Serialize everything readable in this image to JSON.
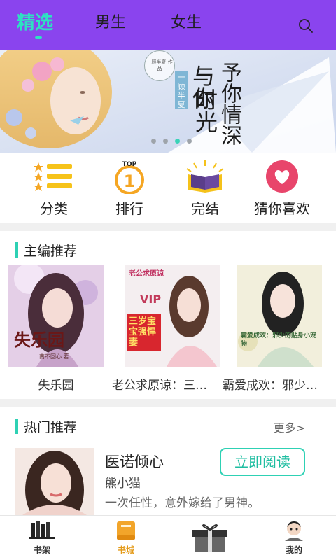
{
  "header": {
    "tabs": [
      {
        "label": "精选",
        "active": true
      },
      {
        "label": "男生",
        "active": false
      },
      {
        "label": "女生",
        "active": false
      }
    ],
    "search_icon": "search-icon",
    "background_color": "#8a44ee",
    "active_color": "#2ee0c2"
  },
  "banner": {
    "title_line1": "与你",
    "title_line2": "时光",
    "title_line3": "予你情深",
    "author_tag": "一顾半夏",
    "badge_text": "一顾半夏 作品",
    "dots": [
      false,
      false,
      true,
      false
    ]
  },
  "categories": [
    {
      "label": "分类",
      "icon": "list-icon"
    },
    {
      "label": "排行",
      "icon": "top1-icon",
      "icon_text_top": "TOP",
      "icon_text_num": "1"
    },
    {
      "label": "完结",
      "icon": "open-book-icon"
    },
    {
      "label": "猜你喜欢",
      "icon": "heart-icon"
    }
  ],
  "editor_picks": {
    "title": "主编推荐",
    "books": [
      {
        "title": "失乐园",
        "cover_text": "失乐园",
        "cover_author": "南不回心 著"
      },
      {
        "title": "老公求原谅：三…",
        "cover_text": "三岁宝宝强悍妻",
        "cover_badge": "VIP",
        "cover_top": "老公求原谅"
      },
      {
        "title": "霸爱成欢：邪少…",
        "cover_text": "霸爱成欢：邪少的贴身小宠物"
      }
    ]
  },
  "hot": {
    "title": "热门推荐",
    "more_label": "更多>",
    "item": {
      "name": "医诺倾心",
      "author": "熊小猫",
      "description": "一次任性，意外嫁给了男神。",
      "read_button": "立即阅读"
    }
  },
  "bottom_nav": [
    {
      "label": "书架",
      "icon": "bookshelf-icon",
      "active": false
    },
    {
      "label": "书城",
      "icon": "book-store-icon",
      "active": true
    },
    {
      "label": "",
      "icon": "gift-box-icon",
      "active": false
    },
    {
      "label": "我的",
      "icon": "profile-icon",
      "active": false
    }
  ]
}
